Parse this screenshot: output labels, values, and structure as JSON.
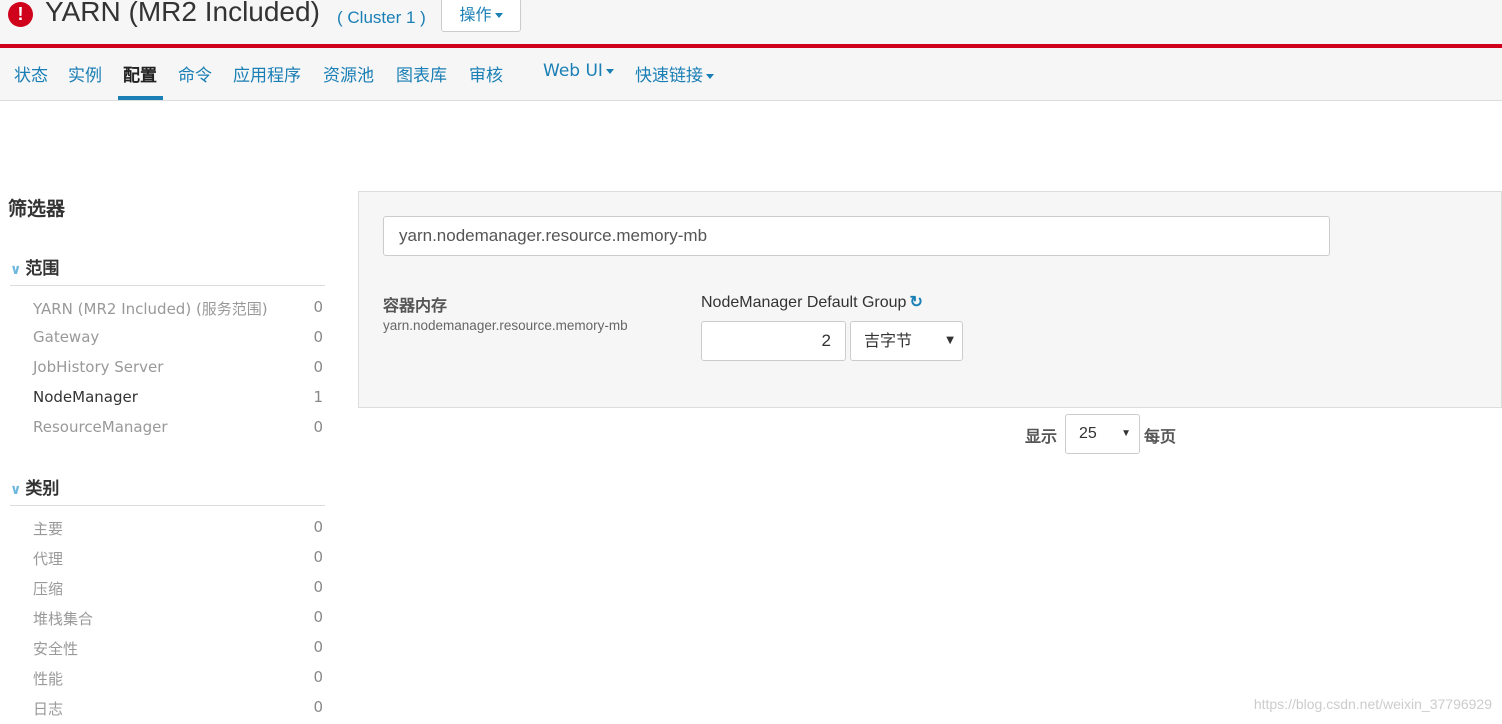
{
  "header": {
    "title": "YARN (MR2 Included)",
    "cluster": "( Cluster 1 )",
    "actions_label": "操作",
    "alert_glyph": "!"
  },
  "tabs": [
    {
      "label": "状态",
      "active": false
    },
    {
      "label": "实例",
      "active": false
    },
    {
      "label": "配置",
      "active": true
    },
    {
      "label": "命令",
      "active": false
    },
    {
      "label": "应用程序",
      "active": false
    },
    {
      "label": "资源池",
      "active": false
    },
    {
      "label": "图表库",
      "active": false
    },
    {
      "label": "审核",
      "active": false
    },
    {
      "label": "Web UI",
      "active": false,
      "dropdown": true
    },
    {
      "label": "快速链接",
      "active": false,
      "dropdown": true
    }
  ],
  "filters": {
    "title": "筛选器",
    "scope": {
      "heading": "范围",
      "items": [
        {
          "label": "YARN (MR2 Included) (服务范围)",
          "count": "0"
        },
        {
          "label": "Gateway",
          "count": "0"
        },
        {
          "label": "JobHistory Server",
          "count": "0"
        },
        {
          "label": "NodeManager",
          "count": "1"
        },
        {
          "label": "ResourceManager",
          "count": "0"
        }
      ]
    },
    "category": {
      "heading": "类别",
      "items": [
        {
          "label": "主要",
          "count": "0"
        },
        {
          "label": "代理",
          "count": "0"
        },
        {
          "label": "压缩",
          "count": "0"
        },
        {
          "label": "堆栈集合",
          "count": "0"
        },
        {
          "label": "安全性",
          "count": "0"
        },
        {
          "label": "性能",
          "count": "0"
        },
        {
          "label": "日志",
          "count": "0"
        }
      ]
    }
  },
  "config": {
    "search_value": "yarn.nodemanager.resource.memory-mb",
    "property_name": "容器内存",
    "property_key": "yarn.nodemanager.resource.memory-mb",
    "group_name": "NodeManager Default Group",
    "value": "2",
    "unit": "吉字节"
  },
  "pager": {
    "prefix": "显示",
    "page_size": "25",
    "suffix": "每页"
  },
  "watermark": "https://blog.csdn.net/weixin_37796929",
  "colors": {
    "brand_red": "#d0021b",
    "link_blue": "#1a7fb5"
  },
  "icons": [
    "alert-icon",
    "caret-down-icon",
    "chevron-down-icon",
    "reset-icon"
  ]
}
